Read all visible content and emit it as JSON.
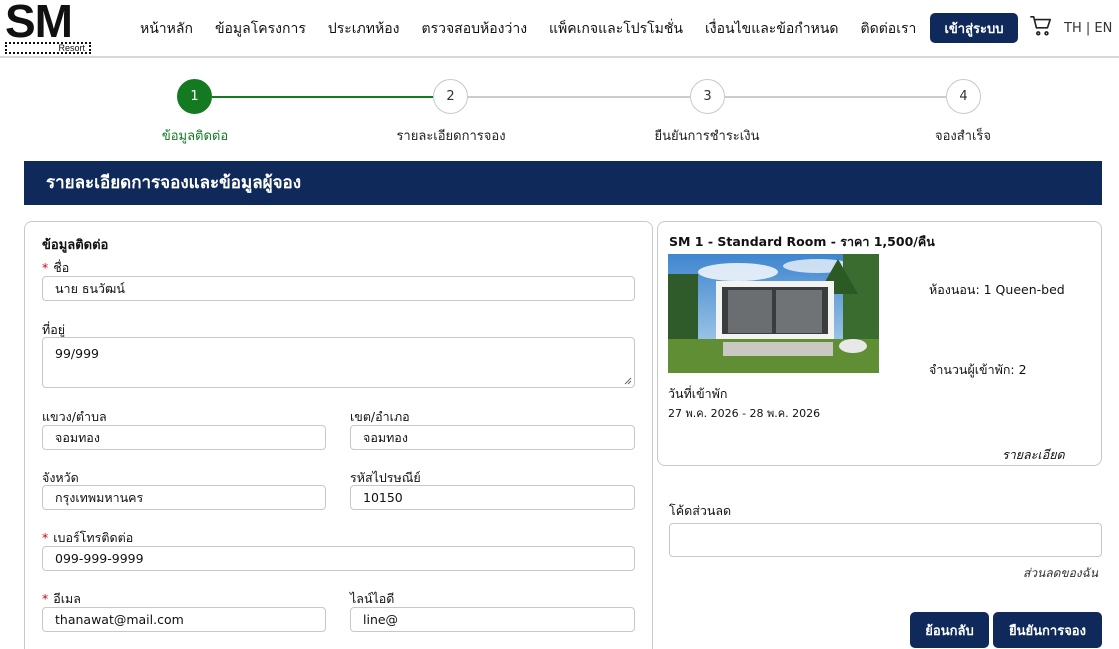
{
  "brand": {
    "logo_main": "SM",
    "logo_sub": "Resort"
  },
  "nav": {
    "items": [
      "หน้าหลัก",
      "ข้อมูลโครงการ",
      "ประเภทห้อง",
      "ตรวจสอบห้องว่าง",
      "แพ็คเกจและโปรโมชั่น",
      "เงื่อนไขและข้อกำหนด",
      "ติดต่อเรา"
    ],
    "login_label": "เข้าสู่ระบบ",
    "lang_label": "TH |  EN"
  },
  "stepper": {
    "steps": [
      {
        "number": "1",
        "label": "ข้อมูลติดต่อ",
        "active": true
      },
      {
        "number": "2",
        "label": "รายละเอียดการจอง",
        "active": false
      },
      {
        "number": "3",
        "label": "ยืนยันการชำระเงิน",
        "active": false
      },
      {
        "number": "4",
        "label": "จองสำเร็จ",
        "active": false
      }
    ]
  },
  "page_title": "รายละเอียดการจองและข้อมูลผู้จอง",
  "form": {
    "heading": "ข้อมูลติดต่อ",
    "name_label": "ชื่อ",
    "name_value": "นาย ธนวัฒน์",
    "address_label": "ที่อยู่",
    "address_value": "99/999",
    "subdistrict_label": "แขวง/ตำบล",
    "subdistrict_value": "จอมทอง",
    "district_label": "เขต/อำเภอ",
    "district_value": "จอมทอง",
    "province_label": "จังหวัด",
    "province_value": "กรุงเทพมหานคร",
    "postcode_label": "รหัสไปรษณีย์",
    "postcode_value": "10150",
    "phone_label": "เบอร์โทรติดต่อ",
    "phone_value": "099-999-9999",
    "email_label": "อีเมล",
    "email_value": "thanawat@mail.com",
    "line_label": "ไลน์ไอดี",
    "line_value": "line@",
    "required_mark": "*"
  },
  "room": {
    "title": "SM 1 - Standard Room - ราคา 1,500/คืน",
    "bed": "ห้องนอน: 1 Queen-bed",
    "guests": "จำนวนผู้เข้าพัก: 2",
    "checkin_label": "วันที่เข้าพัก",
    "dates": "27 พ.ค. 2026 - 28 พ.ค. 2026",
    "detail_link": "รายละเอียด"
  },
  "discount": {
    "label": "โค้ดส่วนลด",
    "value": "",
    "note": "ส่วนลดของฉัน"
  },
  "actions": {
    "back_label": "ย้อนกลับ",
    "confirm_label": "ยืนยันการจอง"
  },
  "colors": {
    "navy": "#0f2a5a",
    "green": "#137a22",
    "required": "#d0021b"
  }
}
